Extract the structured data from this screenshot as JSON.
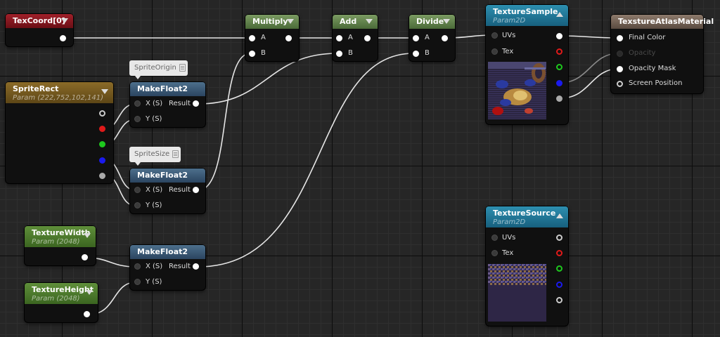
{
  "nodes": {
    "texcoord": {
      "title": "TexCoord[0]"
    },
    "spriterect": {
      "title": "SpriteRect",
      "subtitle": "Param (222,752,102,141)"
    },
    "mf_origin": {
      "title": "MakeFloat2",
      "in_x": "X (S)",
      "in_y": "Y (S)",
      "out": "Result",
      "comment": "SpriteOrigin"
    },
    "mf_size": {
      "title": "MakeFloat2",
      "in_x": "X (S)",
      "in_y": "Y (S)",
      "out": "Result",
      "comment": "SpriteSize"
    },
    "mf_tex": {
      "title": "MakeFloat2",
      "in_x": "X (S)",
      "in_y": "Y (S)",
      "out": "Result"
    },
    "texwidth": {
      "title": "TextureWidth",
      "subtitle": "Param (2048)"
    },
    "texheight": {
      "title": "TextureHeight",
      "subtitle": "Param (2048)"
    },
    "multiply": {
      "title": "Multiply",
      "in_a": "A",
      "in_b": "B"
    },
    "add": {
      "title": "Add",
      "in_a": "A",
      "in_b": "B"
    },
    "divide": {
      "title": "Divide",
      "in_a": "A",
      "in_b": "B"
    },
    "texsample": {
      "title": "TextureSample",
      "subtitle": "Param2D",
      "in_uvs": "UVs",
      "in_tex": "Tex"
    },
    "texsource": {
      "title": "TextureSource",
      "subtitle": "Param2D",
      "in_uvs": "UVs",
      "in_tex": "Tex"
    },
    "material": {
      "title": "TexstureAtlasMaterial",
      "inputs": [
        "Final Color",
        "Opacity",
        "Opacity Mask",
        "Screen Position"
      ]
    }
  },
  "colors": {
    "pin_red": "#e01a1a",
    "pin_green": "#1ec81e",
    "pin_blue": "#1a1aee",
    "pin_white": "#ffffff",
    "pin_grey": "#aaaaaa",
    "wire": "#e6e6e6"
  }
}
